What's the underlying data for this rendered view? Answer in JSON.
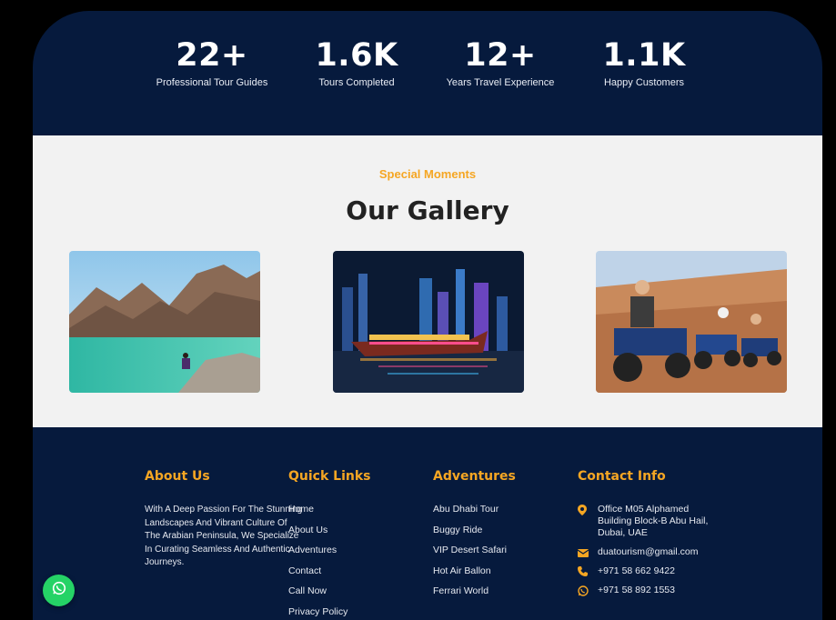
{
  "stats": [
    {
      "value": "22+",
      "label": "Professional Tour Guides"
    },
    {
      "value": "1.6K",
      "label": "Tours Completed"
    },
    {
      "value": "12+",
      "label": "Years Travel Experience"
    },
    {
      "value": "1.1K",
      "label": "Happy Customers"
    }
  ],
  "gallery": {
    "eyebrow": "Special Moments",
    "title": "Our Gallery",
    "images": [
      "mountain-lake-photo",
      "dhow-cruise-night-photo",
      "quad-bike-desert-photo"
    ]
  },
  "footer": {
    "about": {
      "heading": "About Us",
      "text": "With A Deep Passion For The Stunning Landscapes And Vibrant Culture Of The Arabian Peninsula, We Specialize In Curating Seamless And Authentic Journeys."
    },
    "quick_links": {
      "heading": "Quick Links",
      "items": [
        "Home",
        "About Us",
        "Adventures",
        "Contact",
        "Call Now",
        "Privacy Policy"
      ]
    },
    "adventures": {
      "heading": "Adventures",
      "items": [
        "Abu Dhabi Tour",
        "Buggy Ride",
        "VIP Desert Safari",
        "Hot Air Ballon",
        "Ferrari World"
      ]
    },
    "contact": {
      "heading": "Contact Info",
      "address": "Office M05 Alphamed Building Block-B Abu Hail, Dubai, UAE",
      "email": "duatourism@gmail.com",
      "phone": "+971 58 662 9422",
      "whatsapp": "+971 58 892 1553"
    }
  },
  "colors": {
    "navy": "#061a3d",
    "accent": "#f5a623",
    "whatsapp": "#25d366"
  },
  "floating": {
    "icon": "whatsapp-icon"
  }
}
